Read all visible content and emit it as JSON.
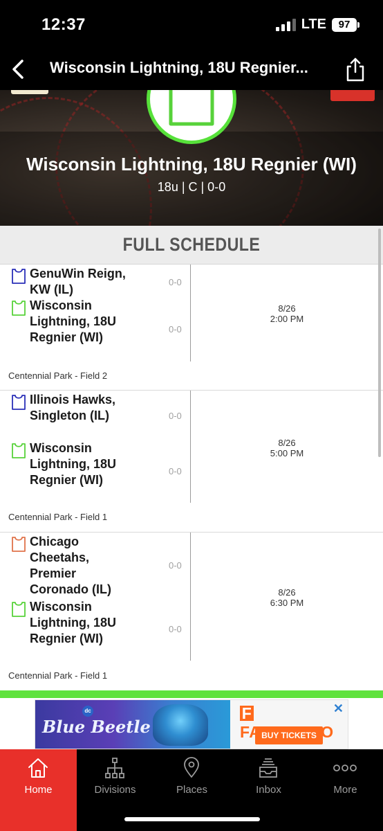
{
  "status_bar": {
    "time": "12:37",
    "network": "LTE",
    "battery": "97"
  },
  "nav": {
    "title": "Wisconsin Lightning, 18U Regnier..."
  },
  "hero": {
    "team_name": "Wisconsin Lightning, 18U Regnier (WI)",
    "meta": "18u | C | 0-0"
  },
  "schedule": {
    "title": "FULL SCHEDULE",
    "games": [
      {
        "home": {
          "name": "GenuWin Reign, KW (IL)",
          "score": "0-0",
          "jersey_color": "#2a2fb8"
        },
        "away": {
          "name": "Wisconsin Lightning, 18U Regnier (WI)",
          "score": "0-0",
          "jersey_color": "#57d23a"
        },
        "date": "8/26",
        "time": "2:00 PM",
        "venue": "Centennial Park - Field 2"
      },
      {
        "home": {
          "name": "Illinois Hawks, Singleton (IL)",
          "score": "0-0",
          "jersey_color": "#2a2fb8"
        },
        "away": {
          "name": "Wisconsin Lightning, 18U Regnier (WI)",
          "score": "0-0",
          "jersey_color": "#57d23a"
        },
        "date": "8/26",
        "time": "5:00 PM",
        "venue": "Centennial Park - Field 1"
      },
      {
        "home": {
          "name": "Chicago Cheetahs, Premier Coronado (IL)",
          "score": "0-0",
          "jersey_color": "#e0734a"
        },
        "away": {
          "name": "Wisconsin Lightning, 18U Regnier (WI)",
          "score": "0-0",
          "jersey_color": "#57d23a"
        },
        "date": "8/26",
        "time": "6:30 PM",
        "venue": "Centennial Park - Field 1"
      }
    ]
  },
  "ad": {
    "brand": "dc",
    "movie_title": "Blue Beetle",
    "sponsor": "FANDANGO",
    "cta": "BUY TICKETS",
    "close_icon": "close-icon"
  },
  "tabs": [
    {
      "label": "Home",
      "icon": "home-icon",
      "active": true
    },
    {
      "label": "Divisions",
      "icon": "bracket-icon",
      "active": false
    },
    {
      "label": "Places",
      "icon": "map-pin-icon",
      "active": false
    },
    {
      "label": "Inbox",
      "icon": "inbox-icon",
      "active": false
    },
    {
      "label": "More",
      "icon": "more-dots-icon",
      "active": false
    }
  ],
  "colors": {
    "accent_red": "#e8302a",
    "accent_green": "#5fe23d",
    "bar_black": "#000000"
  }
}
